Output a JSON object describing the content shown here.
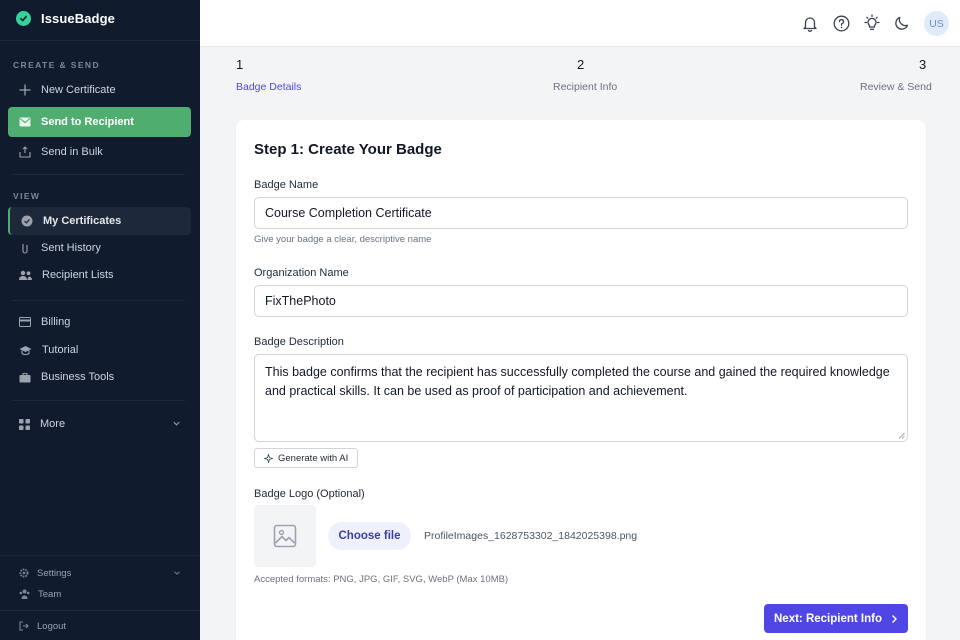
{
  "app": {
    "name": "IssueBadge"
  },
  "sidebar": {
    "sections": {
      "create": "CREATE & SEND",
      "view": "VIEW"
    },
    "items": [
      {
        "label": "New Certificate",
        "icon": "plus-icon"
      },
      {
        "label": "Send to Recipient",
        "icon": "envelope-icon",
        "state": "active"
      },
      {
        "label": "Send in Bulk",
        "icon": "inbox-upload-icon"
      },
      {
        "label": "My Certificates",
        "icon": "check-badge-icon",
        "state": "current"
      },
      {
        "label": "Sent History",
        "icon": "paper-clip-icon"
      },
      {
        "label": "Recipient Lists",
        "icon": "users-icon"
      },
      {
        "label": "Billing",
        "icon": "credit-card-icon"
      },
      {
        "label": "Tutorial",
        "icon": "graduation-cap-icon"
      },
      {
        "label": "Business Tools",
        "icon": "briefcase-icon"
      },
      {
        "label": "More",
        "icon": "grid-icon"
      }
    ],
    "footer": [
      {
        "label": "Settings",
        "icon": "gear-icon"
      },
      {
        "label": "Team",
        "icon": "team-icon"
      },
      {
        "label": "Logout",
        "icon": "logout-icon"
      }
    ]
  },
  "header": {
    "avatar_initials": "US"
  },
  "stepper": {
    "steps": [
      {
        "number": "1",
        "label": "Badge Details",
        "state": "active"
      },
      {
        "number": "2",
        "label": "Recipient Info"
      },
      {
        "number": "3",
        "label": "Review & Send"
      }
    ]
  },
  "form": {
    "title": "Step 1: Create Your Badge",
    "badge_name": {
      "label": "Badge Name",
      "value": "Course Completion Certificate",
      "hint": "Give your badge a clear, descriptive name"
    },
    "org_name": {
      "label": "Organization Name",
      "value": "FixThePhoto"
    },
    "description": {
      "label": "Badge Description",
      "value": "This badge confirms that the recipient has successfully completed the course and gained the required knowledge and practical skills. It can be used as proof of participation and achievement."
    },
    "ai_button": "Generate with AI",
    "logo": {
      "label": "Badge Logo (Optional)",
      "choose_button": "Choose file",
      "file_name": "ProfileImages_1628753302_1842025398.png",
      "formats_hint": "Accepted formats: PNG, JPG, GIF, SVG, WebP (Max 10MB)"
    },
    "next_button": "Next: Recipient Info"
  },
  "colors": {
    "sidebar_bg": "#111b2e",
    "accent_green": "#4fae6f",
    "primary": "#4f46e5"
  }
}
